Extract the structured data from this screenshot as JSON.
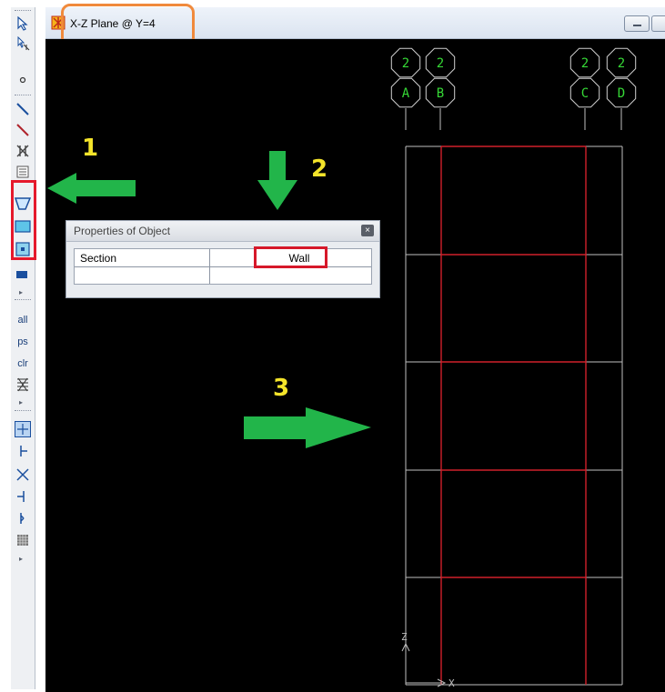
{
  "window": {
    "title": "X-Z Plane @ Y=4"
  },
  "toolbar": {
    "text_buttons": [
      "all",
      "ps",
      "clr"
    ]
  },
  "properties_panel": {
    "title": "Properties of Object",
    "close_label": "×",
    "rows": [
      {
        "label": "Section",
        "value": "Wall"
      },
      {
        "label": "",
        "value": ""
      }
    ]
  },
  "grid_bubbles": [
    {
      "top": "2",
      "bottom": "A"
    },
    {
      "top": "2",
      "bottom": "B"
    },
    {
      "top": "2",
      "bottom": "C"
    },
    {
      "top": "2",
      "bottom": "D"
    }
  ],
  "axes": {
    "vertical": "Z",
    "horizontal": "X"
  },
  "annotations": {
    "step1": "1",
    "step2": "2",
    "step3": "3"
  },
  "colors": {
    "canvas_background": "#000000",
    "grid_lines": "#bfbfbf",
    "wall_outline": "#d0202a",
    "bubble_line": "#36d936",
    "annotation_arrow": "#22b54a",
    "annotation_number": "#f4e42a",
    "highlight_red": "#e5192c",
    "highlight_orange": "#f08a3c"
  }
}
